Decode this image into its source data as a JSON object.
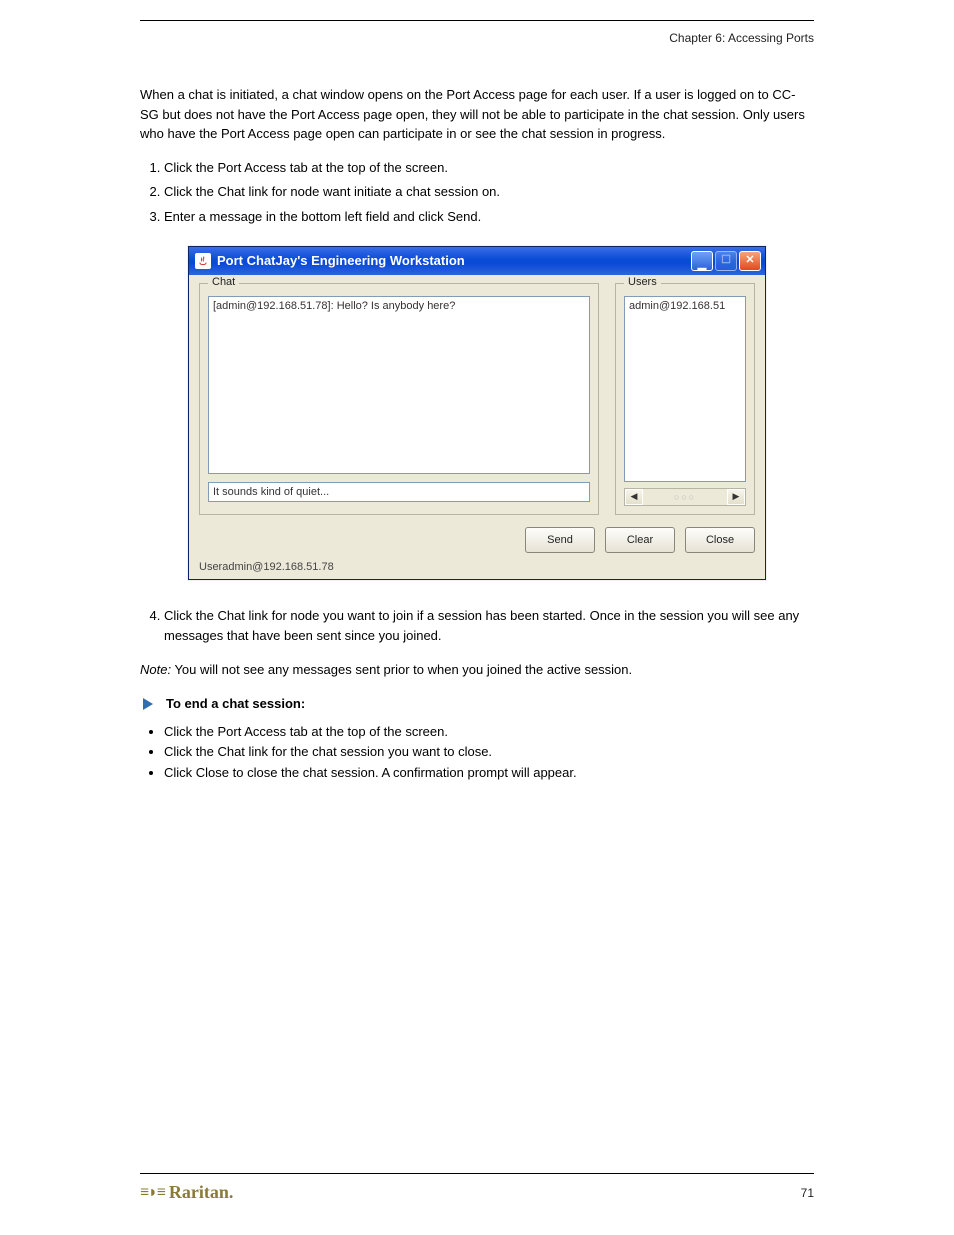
{
  "header": {
    "chapter": "Chapter 6: Accessing Ports"
  },
  "intro": {
    "paragraph": "When a chat is initiated, a chat window opens on the Port Access page for each user. If a user is logged on to CC-SG but does not have the Port Access page open, they will not be able to participate in the chat session. Only users who have the Port Access page open can participate in or see the chat session in progress.",
    "steps": [
      "Click the Port Access tab at the top of the screen.",
      "Click the Chat link for node want initiate a chat session on.",
      "Enter a message in the bottom left field and click Send."
    ]
  },
  "dialog": {
    "title": "Port ChatJay's Engineering Workstation",
    "chat": {
      "legend": "Chat",
      "history": "[admin@192.168.51.78]: Hello? Is anybody here?",
      "input": "It sounds kind of quiet..."
    },
    "users": {
      "legend": "Users",
      "list": "admin@192.168.51"
    },
    "buttons": {
      "send": "Send",
      "clear": "Clear",
      "close": "Close"
    },
    "status": "Useradmin@192.168.51.78"
  },
  "after": {
    "step4": "Click the Chat link for node you want to join if a session has been started. Once in the session you will see any messages that have been sent since you joined.",
    "noteLabel": "Note:",
    "noteText": " You will not see any messages sent prior to when you joined the active session.",
    "endHeading": "To end a chat session:",
    "endSteps": [
      "Click the Port Access tab at the top of the screen.",
      "Click the Chat link for the chat session you want to close.",
      "Click Close to close the chat session. A confirmation prompt will appear."
    ]
  },
  "footer": {
    "brand": "Raritan.",
    "page": "71"
  }
}
